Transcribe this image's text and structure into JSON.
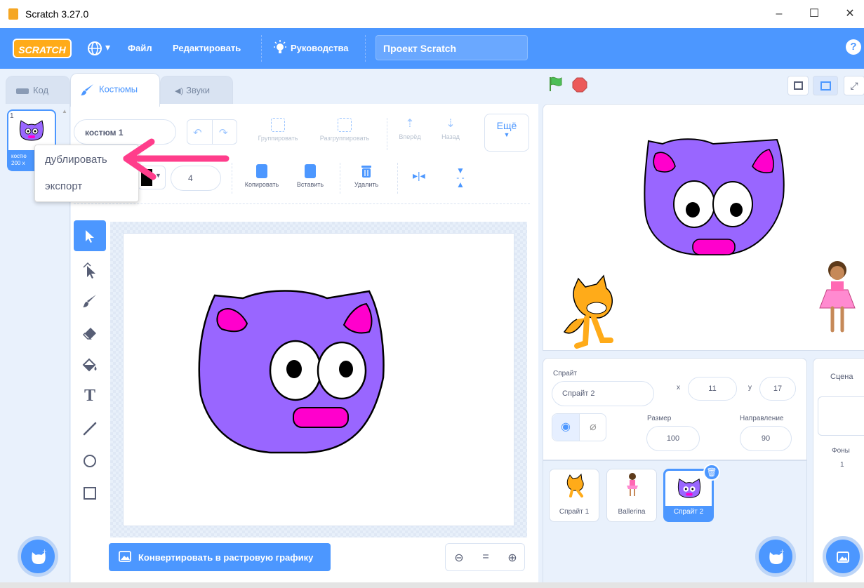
{
  "window": {
    "title": "Scratch 3.27.0",
    "minimize": "–",
    "maximize": "☐",
    "close": "✕"
  },
  "menubar": {
    "logo": "SCRATCH",
    "language_arrow": "▾",
    "file": "Файл",
    "edit": "Редактировать",
    "tutorials": "Руководства",
    "project_title": "Проект Scratch",
    "help": "?"
  },
  "tabs": {
    "code": "Код",
    "costumes": "Костюмы",
    "sounds": "Звуки"
  },
  "costume_list": {
    "index": "1",
    "label_line1": "костю",
    "label_line2": "200 x"
  },
  "context_menu": {
    "duplicate": "дублировать",
    "export": "экспорт"
  },
  "paint_toolbar": {
    "costume_name": "костюм 1",
    "group": "Группировать",
    "ungroup": "Разгруппировать",
    "forward": "Вперёд",
    "backward": "Назад",
    "more": "Ещё",
    "stroke_width": "4",
    "copy": "Копировать",
    "paste": "Вставить",
    "delete": "Удалить"
  },
  "convert_button": "Конвертировать в растровую графику",
  "zoom": {
    "out": "⊖",
    "reset": "=",
    "in": "⊕"
  },
  "sprite_info": {
    "sprite_label": "Спрайт",
    "sprite_name": "Спрайт 2",
    "x_label": "x",
    "x_value": "11",
    "y_label": "y",
    "y_value": "17",
    "size_label": "Размер",
    "size_value": "100",
    "direction_label": "Направление",
    "direction_value": "90"
  },
  "sprites": [
    {
      "name": "Спрайт 1"
    },
    {
      "name": "Ballerina"
    },
    {
      "name": "Спрайт 2"
    }
  ],
  "stage_panel": {
    "title": "Сцена",
    "backdrops_label": "Фоны",
    "backdrops_count": "1"
  },
  "colors": {
    "accent": "#4c97ff",
    "cat_body": "#9966ff",
    "cat_ear": "#ff00cc",
    "arrow": "#ff3d8b"
  }
}
